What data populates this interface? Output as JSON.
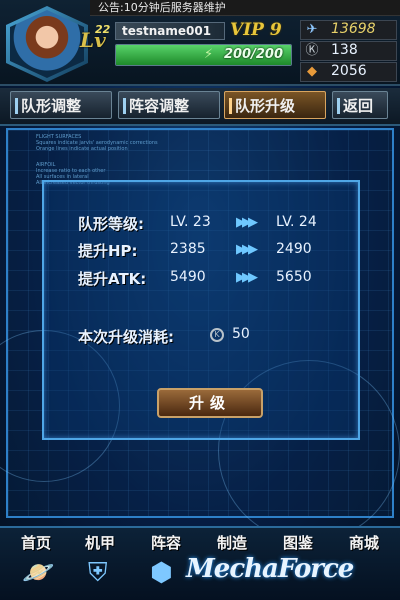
{
  "notice": {
    "text": "公告:10分钟后服务器维护"
  },
  "player": {
    "level_prefix": "Lv",
    "level": "22",
    "name": "testname001",
    "vip": "VIP 9",
    "energy_text": "200/200",
    "energy_fraction": 1.0
  },
  "resources": {
    "gold": "13698",
    "coins": "138",
    "crates": "2056"
  },
  "tabs": [
    {
      "label": "队形调整"
    },
    {
      "label": "阵容调整"
    },
    {
      "label": "队形升级"
    },
    {
      "label": "返回"
    }
  ],
  "panel": {
    "fine_lines": [
      "FLIGHT SURFACES",
      "Squares indicate jarvis' aerodynamic corrections",
      "Orange lines indicate actual position",
      "AIRFOIL",
      "Increase ratio to each other",
      "All surfaces in lateral",
      "All increased vector thrusting"
    ],
    "formation_label": "队形等级:",
    "formation_from": "LV. 23",
    "formation_to": "LV. 24",
    "hp_label": "提升HP:",
    "hp_from": "2385",
    "hp_to": "2490",
    "atk_label": "提升ATK:",
    "atk_from": "5490",
    "atk_to": "5650",
    "cost_label": "本次升级消耗:",
    "cost_value": "50",
    "upgrade_button": "升级"
  },
  "nav": [
    {
      "label": "首页"
    },
    {
      "label": "机甲"
    },
    {
      "label": "阵容"
    },
    {
      "label": "制造"
    },
    {
      "label": "图鉴"
    },
    {
      "label": "商城"
    }
  ],
  "logo": {
    "text": "MechaForce"
  }
}
